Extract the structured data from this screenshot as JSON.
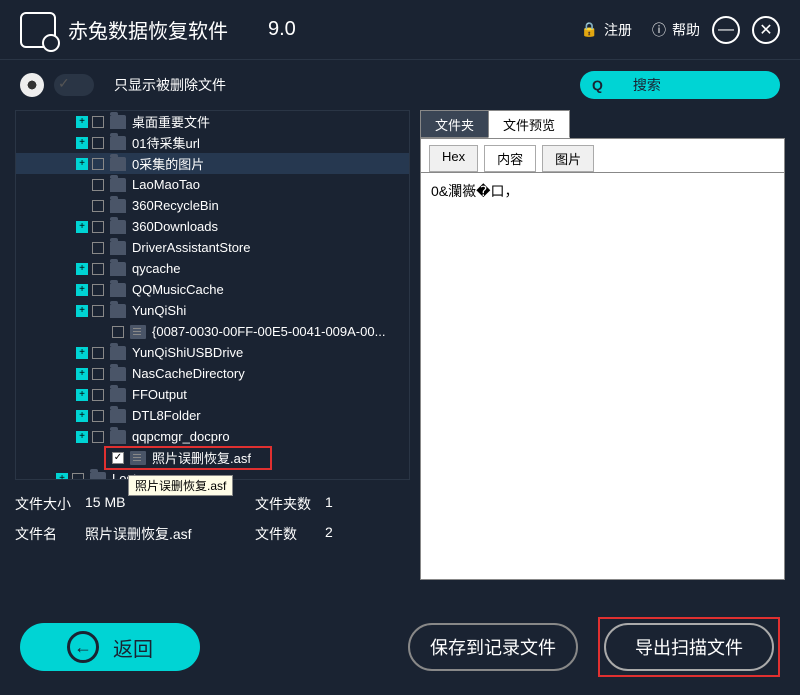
{
  "app": {
    "title": "赤兔数据恢复软件",
    "version": "9.0"
  },
  "top": {
    "register": "注册",
    "help": "帮助"
  },
  "toolbar": {
    "filter_label": "只显示被删除文件",
    "search_label": "搜索"
  },
  "tree": {
    "items": [
      {
        "label": "桌面重要文件",
        "type": "folder",
        "expand": true,
        "indent": 1
      },
      {
        "label": "01待采集url",
        "type": "folder",
        "expand": true,
        "indent": 1
      },
      {
        "label": "0采集的图片",
        "type": "folder",
        "expand": true,
        "indent": 1,
        "highlight": true
      },
      {
        "label": "LaoMaoTao",
        "type": "folder",
        "expand": false,
        "indent": 1
      },
      {
        "label": "360RecycleBin",
        "type": "folder",
        "expand": false,
        "indent": 1
      },
      {
        "label": "360Downloads",
        "type": "folder",
        "expand": true,
        "indent": 1
      },
      {
        "label": "DriverAssistantStore",
        "type": "folder",
        "expand": false,
        "indent": 1
      },
      {
        "label": "qycache",
        "type": "folder",
        "expand": true,
        "indent": 1
      },
      {
        "label": "QQMusicCache",
        "type": "folder",
        "expand": true,
        "indent": 1
      },
      {
        "label": "YunQiShi",
        "type": "folder",
        "expand": true,
        "indent": 1
      },
      {
        "label": "{0087-0030-00FF-00E5-0041-009A-00...",
        "type": "file",
        "expand": false,
        "indent": 2
      },
      {
        "label": "YunQiShiUSBDrive",
        "type": "folder",
        "expand": true,
        "indent": 1
      },
      {
        "label": "NasCacheDirectory",
        "type": "folder",
        "expand": true,
        "indent": 1
      },
      {
        "label": "FFOutput",
        "type": "folder",
        "expand": true,
        "indent": 1
      },
      {
        "label": "DTL8Folder",
        "type": "folder",
        "expand": true,
        "indent": 1
      },
      {
        "label": "qqpcmgr_docpro",
        "type": "folder",
        "expand": true,
        "indent": 1
      },
      {
        "label": "照片误删恢复.asf",
        "type": "file",
        "expand": false,
        "indent": 2,
        "checked": true,
        "selected": true
      },
      {
        "label": "Lost",
        "type": "folder",
        "expand": true,
        "indent": 0
      }
    ],
    "tooltip": "照片误删恢复.asf"
  },
  "stats": {
    "size_label": "文件大小",
    "size_value": "15 MB",
    "folder_count_label": "文件夹数",
    "folder_count_value": "1",
    "name_label": "文件名",
    "name_value": "照片误删恢复.asf",
    "file_count_label": "文件数",
    "file_count_value": "2"
  },
  "preview": {
    "tabs": {
      "folder": "文件夹",
      "preview": "文件预览"
    },
    "subtabs": {
      "hex": "Hex",
      "content": "内容",
      "image": "图片"
    },
    "content": "0&瀾嶶�口，"
  },
  "buttons": {
    "back": "返回",
    "save": "保存到记录文件",
    "export": "导出扫描文件"
  }
}
